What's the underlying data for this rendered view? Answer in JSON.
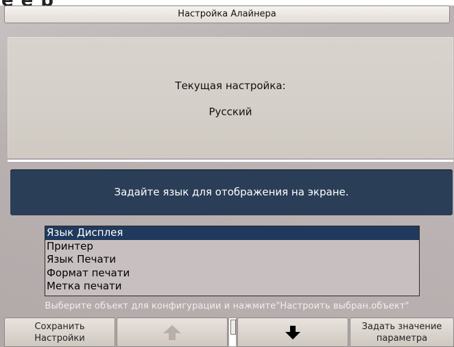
{
  "header": {
    "logo_text": "e e p"
  },
  "window": {
    "title": "Настройка Алайнера"
  },
  "current": {
    "label": "Текущая настройка:",
    "value": "Русский"
  },
  "prompt": {
    "text": "Задайте язык для отображения на экране."
  },
  "list": {
    "items": [
      {
        "label": "Язык Дисплея",
        "selected": true
      },
      {
        "label": "Принтер",
        "selected": false
      },
      {
        "label": "Язык Печати",
        "selected": false
      },
      {
        "label": "Формат печати",
        "selected": false
      },
      {
        "label": "Метка печати",
        "selected": false
      }
    ]
  },
  "hint": "Выберите объект для конфигурации и нажмите\"Настроить выбран.объект\"",
  "toolbar": {
    "save_label_line1": "Сохранить",
    "save_label_line2": "Настройки",
    "up_icon": "arrow-up-icon",
    "down_icon": "arrow-down-icon",
    "set_label_line1": "Задать значение",
    "set_label_line2": "параметра"
  },
  "colors": {
    "prompt_bg": "#2a3e57",
    "selected_bg": "#1f3a5c",
    "up_arrow_disabled": "#b8b0a8",
    "down_arrow": "#000000"
  }
}
